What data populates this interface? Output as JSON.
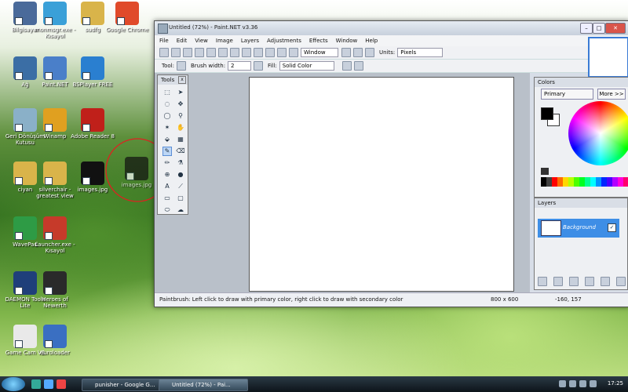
{
  "desktop": {
    "icons": [
      {
        "label": "Bilgisayar",
        "color": "#4a6a9a"
      },
      {
        "label": "Ağ",
        "color": "#3b6ea5"
      },
      {
        "label": "Geri Dönüşüm Kutusu",
        "color": "#8ab0c8"
      },
      {
        "label": "ciyan",
        "color": "#d9b44a"
      },
      {
        "label": "WavePad",
        "color": "#2e9b45"
      },
      {
        "label": "DAEMON Tools Lite",
        "color": "#1f3f7a"
      },
      {
        "label": "Game Cam V2",
        "color": "#e9e9e9"
      },
      {
        "label": "monmsgr.exe - Kısayol",
        "color": "#3aa0d8"
      },
      {
        "label": "Paint.NET",
        "color": "#4a7fc9"
      },
      {
        "label": "Winamp",
        "color": "#e0a020"
      },
      {
        "label": "silverchair - greatest view",
        "color": "#d9b44a"
      },
      {
        "label": "Launcher.exe - Kısayol",
        "color": "#c63a2a"
      },
      {
        "label": "Heroes of Newerth",
        "color": "#2a2a2a"
      },
      {
        "label": "euroloader",
        "color": "#3a6fc2"
      },
      {
        "label": "sudfg",
        "color": "#d9b44a"
      },
      {
        "label": "BSPlayer FREE",
        "color": "#2a7fd0"
      },
      {
        "label": "Adobe Reader 8",
        "color": "#c0201a"
      },
      {
        "label": "images.jpg",
        "color": "#111111"
      },
      {
        "label": "Google Chrome",
        "color": "#e04a2a"
      },
      {
        "label": "images.jpg",
        "color": "#111111"
      }
    ]
  },
  "window": {
    "title": "Untitled (72%) - Paint.NET v3.36",
    "menu": [
      "File",
      "Edit",
      "View",
      "Image",
      "Layers",
      "Adjustments",
      "Effects",
      "Window",
      "Help"
    ],
    "toolbar1": {
      "zoom_label": "Window",
      "units_label": "Units:",
      "units_value": "Pixels"
    },
    "toolbar2": {
      "tool_label": "Tool:",
      "brush_label": "Brush width:",
      "brush_value": "2",
      "fill_label": "Fill:",
      "fill_value": "Solid Color"
    },
    "status": {
      "hint": "Paintbrush: Left click to draw with primary color, right click to draw with secondary color",
      "size": "800 x 600",
      "coords": "-160, 157"
    }
  },
  "tools_panel": {
    "title": "Tools"
  },
  "colors_panel": {
    "title": "Colors",
    "dropdown_value": "Primary",
    "more_label": "More >>",
    "primary_color": "#000000",
    "secondary_color": "#ffffff",
    "palette": [
      "#000000",
      "#404040",
      "#ff0000",
      "#ff6a00",
      "#ffd800",
      "#b6ff00",
      "#4cff00",
      "#00ff21",
      "#00ff90",
      "#00ffff",
      "#0094ff",
      "#0026ff",
      "#4800ff",
      "#b200ff",
      "#ff00dc",
      "#ff006e"
    ]
  },
  "layers_panel": {
    "title": "Layers",
    "layer_name": "Background",
    "layer_visible": "✓"
  },
  "taskbar": {
    "buttons": [
      "punisher - Google G...",
      "Untitled (72%) - Pai..."
    ],
    "time": "17:25"
  }
}
